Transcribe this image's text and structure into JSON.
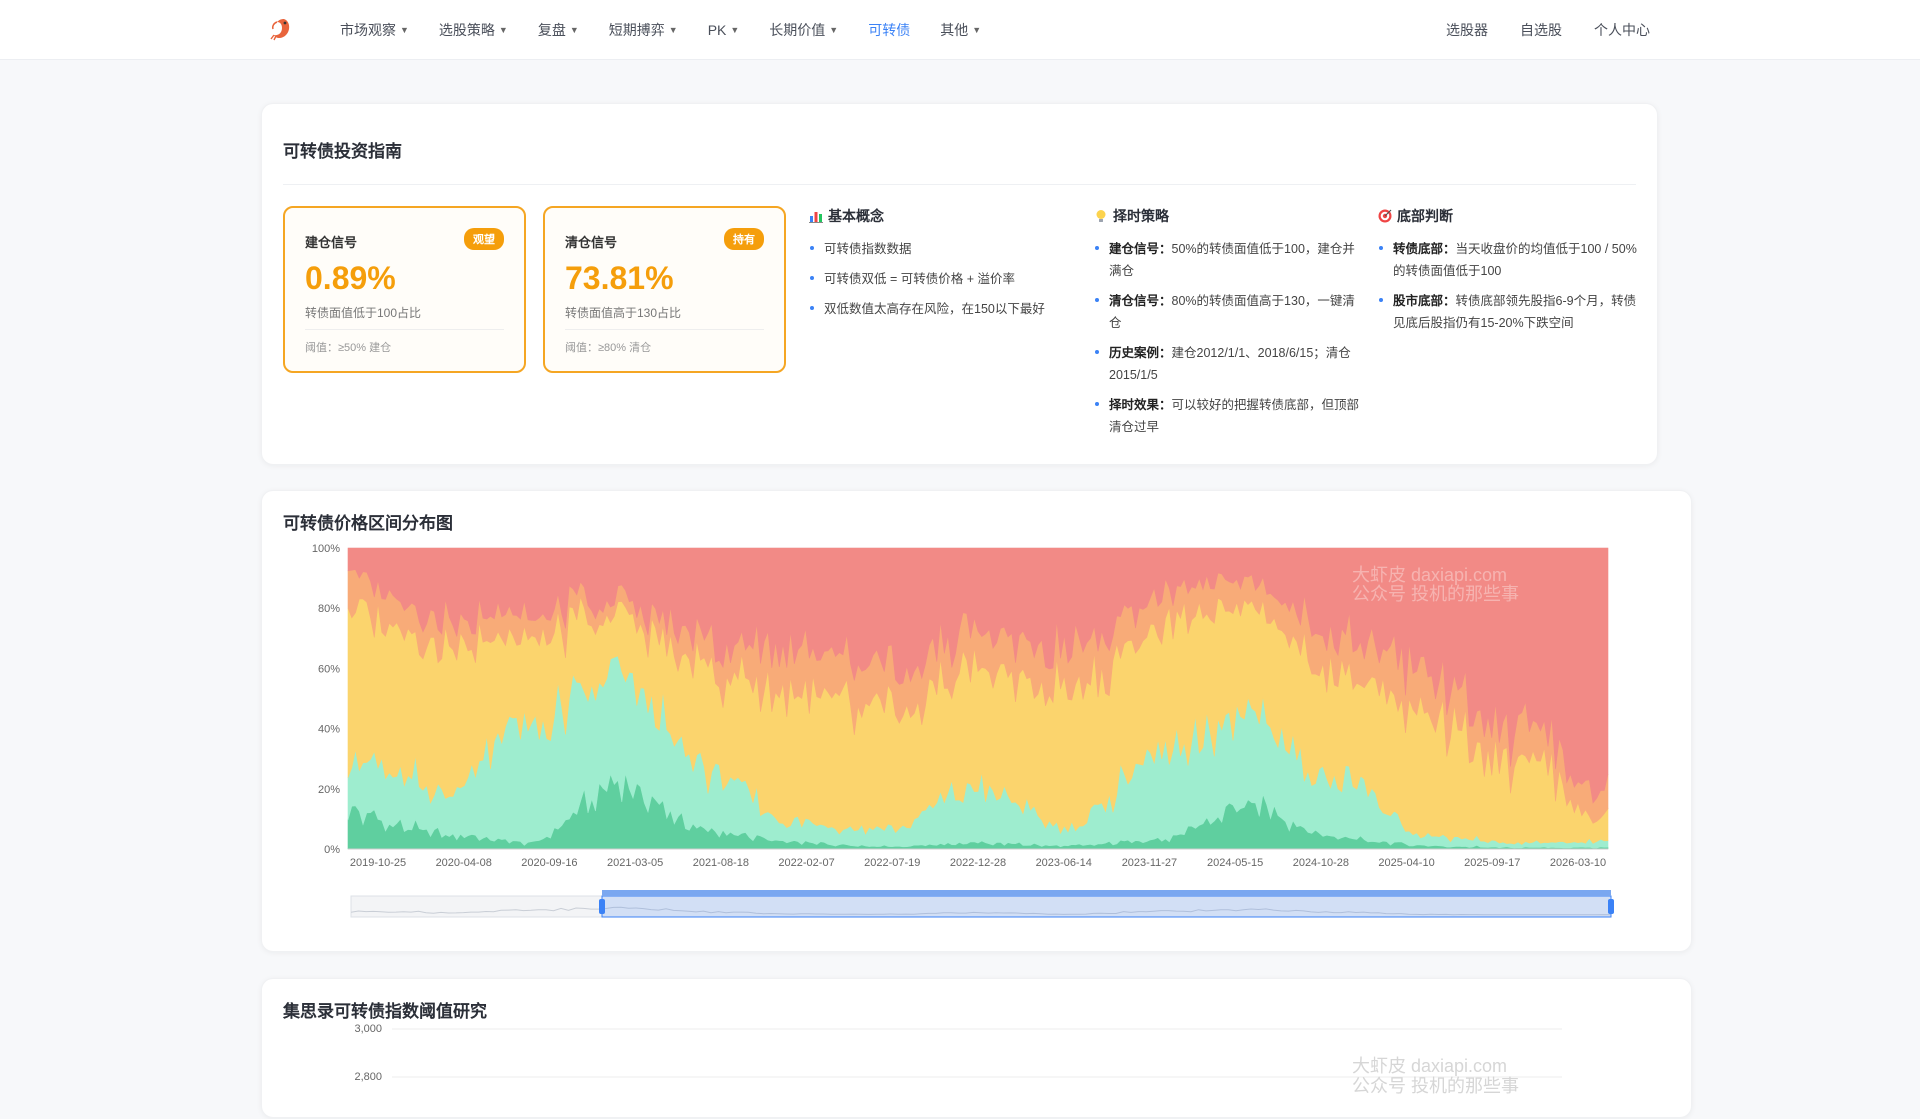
{
  "nav": {
    "items": [
      {
        "label": "市场观察",
        "dropdown": true,
        "active": false
      },
      {
        "label": "选股策略",
        "dropdown": true,
        "active": false
      },
      {
        "label": "复盘",
        "dropdown": true,
        "active": false
      },
      {
        "label": "短期搏弈",
        "dropdown": true,
        "active": false
      },
      {
        "label": "PK",
        "dropdown": true,
        "active": false
      },
      {
        "label": "长期价值",
        "dropdown": true,
        "active": false
      },
      {
        "label": "可转债",
        "dropdown": false,
        "active": true
      },
      {
        "label": "其他",
        "dropdown": true,
        "active": false
      }
    ],
    "right": [
      "选股器",
      "自选股",
      "个人中心"
    ]
  },
  "guide": {
    "title": "可转债投资指南",
    "signals": [
      {
        "label": "建仓信号",
        "badge": "观望",
        "value": "0.89%",
        "desc": "转债面值低于100占比",
        "threshold": "阈值：≥50% 建仓"
      },
      {
        "label": "清仓信号",
        "badge": "持有",
        "value": "73.81%",
        "desc": "转债面值高于130占比",
        "threshold": "阈值：≥80% 清仓"
      }
    ],
    "columns": [
      {
        "title": "基本概念",
        "icon": "bar-chart-icon",
        "items": [
          {
            "bold": "",
            "text": "可转债指数数据"
          },
          {
            "bold": "",
            "text": "可转债双低 = 可转债价格 + 溢价率"
          },
          {
            "bold": "",
            "text": "双低数值太高存在风险，在150以下最好"
          }
        ]
      },
      {
        "title": "择时策略",
        "icon": "lightbulb-icon",
        "items": [
          {
            "bold": "建仓信号：",
            "text": "50%的转债面值低于100，建仓并满仓"
          },
          {
            "bold": "清仓信号：",
            "text": "80%的转债面值高于130，一键清仓"
          },
          {
            "bold": "历史案例：",
            "text": "建仓2012/1/1、2018/6/15；清仓2015/1/5"
          },
          {
            "bold": "择时效果：",
            "text": "可以较好的把握转债底部，但顶部清仓过早"
          }
        ]
      },
      {
        "title": "底部判断",
        "icon": "target-icon",
        "items": [
          {
            "bold": "转债底部：",
            "text": "当天收盘价的均值低于100 / 50%的转债面值低于100"
          },
          {
            "bold": "股市底部：",
            "text": "转债底部领先股指6-9个月，转债见底后股指仍有15-20%下跌空间"
          }
        ]
      }
    ]
  },
  "chart_data": {
    "type": "area",
    "stacked": true,
    "percent": true,
    "title": "可转债价格区间分布图",
    "ylim": [
      0,
      100
    ],
    "y_ticks": [
      "0%",
      "20%",
      "40%",
      "60%",
      "80%",
      "100%"
    ],
    "x_ticks": [
      "2019-10-25",
      "2020-04-08",
      "2020-09-16",
      "2021-03-05",
      "2021-08-18",
      "2022-02-07",
      "2022-07-19",
      "2022-12-28",
      "2023-06-14",
      "2023-11-27",
      "2024-05-15",
      "2024-10-28",
      "2025-04-10",
      "2025-09-17",
      "2026-03-10"
    ],
    "x": [
      "2019-10-25",
      "2020-04-08",
      "2020-09-16",
      "2021-03-05",
      "2021-08-18",
      "2022-02-07",
      "2022-07-19",
      "2022-12-28",
      "2023-06-14",
      "2023-11-27",
      "2024-05-15",
      "2024-10-28",
      "2025-04-10",
      "2025-09-17",
      "2026-03-10"
    ],
    "series": [
      {
        "color": "#5fcf9f",
        "values": [
          12,
          5,
          2,
          22,
          6,
          2,
          1,
          2,
          1,
          3,
          14,
          4,
          1,
          0.5,
          0.5
        ]
      },
      {
        "color": "#9eedcf",
        "values": [
          18,
          14,
          38,
          37,
          20,
          6,
          6,
          18,
          6,
          28,
          30,
          19,
          3,
          1.5,
          2
        ]
      },
      {
        "color": "#fbd46d",
        "values": [
          50,
          51,
          30,
          19,
          33,
          42,
          37,
          40,
          43,
          42,
          38,
          37,
          40,
          25,
          7
        ]
      },
      {
        "color": "#f8ab78",
        "values": [
          12,
          8,
          8,
          5,
          10,
          15,
          14,
          12,
          13,
          11,
          8,
          12,
          14,
          11,
          8
        ]
      },
      {
        "color": "#f28a86",
        "values": [
          8,
          22,
          22,
          17,
          31,
          35,
          42,
          28,
          37,
          16,
          10,
          28,
          42,
          62,
          82.5
        ]
      }
    ],
    "watermark": [
      "大虾皮 daxiapi.com",
      "公众号 投机的那些事"
    ]
  },
  "bottom": {
    "title": "集思录可转债指数阈值研究",
    "y_ticks": [
      "3,000",
      "2,800"
    ]
  }
}
